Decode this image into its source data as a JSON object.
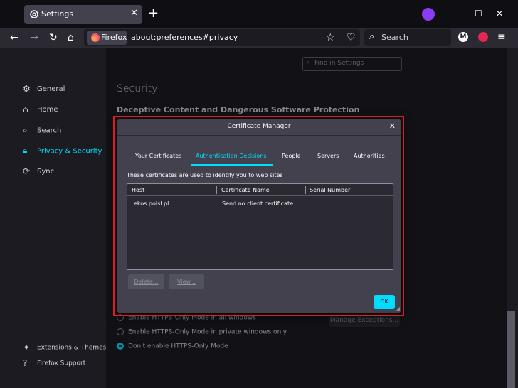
{
  "browser": {
    "tab_title": "Settings",
    "new_tab_icon": "+",
    "window_controls": [
      "—",
      "☐",
      "✕"
    ],
    "identity_label": "Firefox",
    "url": "about:preferences#privacy",
    "search_placeholder": "Search",
    "profile_initial": "M"
  },
  "settings": {
    "find_placeholder": "Find in Settings",
    "nav": [
      {
        "label": "General",
        "icon": "gear-icon"
      },
      {
        "label": "Home",
        "icon": "home-icon"
      },
      {
        "label": "Search",
        "icon": "search-icon"
      },
      {
        "label": "Privacy & Security",
        "icon": "lock-icon",
        "active": true
      },
      {
        "label": "Sync",
        "icon": "sync-icon"
      }
    ],
    "footer_nav": [
      {
        "label": "Extensions & Themes",
        "icon": "puzzle-icon"
      },
      {
        "label": "Firefox Support",
        "icon": "help-icon"
      }
    ],
    "section_title": "Security",
    "subsection_title": "Deceptive Content and Dangerous Software Protection",
    "https_options": [
      {
        "label": "Enable HTTPS-Only Mode in all windows",
        "selected": false
      },
      {
        "label": "Enable HTTPS-Only Mode in private windows only",
        "selected": false
      },
      {
        "label": "Don't enable HTTPS-Only Mode",
        "selected": true
      }
    ],
    "manage_exceptions_label": "Manage Exceptions..."
  },
  "dialog": {
    "title": "Certificate Manager",
    "tabs": [
      {
        "label": "Your Certificates"
      },
      {
        "label": "Authentication Decisions",
        "active": true
      },
      {
        "label": "People"
      },
      {
        "label": "Servers"
      },
      {
        "label": "Authorities"
      }
    ],
    "description": "These certificates are used to identify you to web sites",
    "columns": [
      "Host",
      "Certificate Name",
      "Serial Number"
    ],
    "rows": [
      {
        "host": "ekos.polsl.pl",
        "certificate_name": "Send no client certificate",
        "serial_number": ""
      }
    ],
    "delete_label": "Delete...",
    "view_label": "View...",
    "ok_label": "OK"
  },
  "colors": {
    "accent": "#00ddff",
    "highlight_border": "#e01b24",
    "dialog_bg": "#42414d",
    "page_bg": "#1c1b22"
  }
}
